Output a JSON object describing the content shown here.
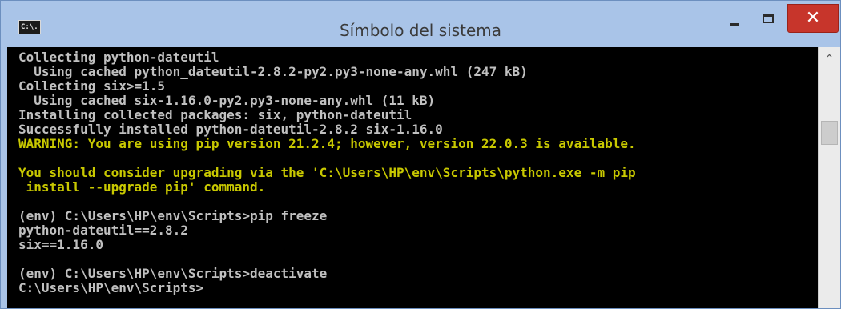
{
  "window": {
    "title": "Símbolo del sistema",
    "icon_label": "C:\\.",
    "icons": {
      "app": "console-icon",
      "minimize": "minimize-icon",
      "maximize": "maximize-icon",
      "close": "close-icon",
      "scroll_up": "chevron-up-icon"
    },
    "controls": {
      "close_glyph": "✕",
      "scroll_up_glyph": "⌃"
    },
    "colors": {
      "title_bar": "#a9c4e8",
      "close_button": "#c7352b",
      "console_background": "#000000",
      "console_text": "#c0c0c0",
      "warning_text": "#c8c800"
    }
  },
  "console": {
    "lines": [
      "Collecting python-dateutil",
      "  Using cached python_dateutil-2.8.2-py2.py3-none-any.whl (247 kB)",
      "Collecting six>=1.5",
      "  Using cached six-1.16.0-py2.py3-none-any.whl (11 kB)",
      "Installing collected packages: six, python-dateutil",
      "Successfully installed python-dateutil-2.8.2 six-1.16.0",
      "WARNING: You are using pip version 21.2.4; however, version 22.0.3 is available.",
      "",
      "You should consider upgrading via the 'C:\\Users\\HP\\env\\Scripts\\python.exe -m pip",
      " install --upgrade pip' command.",
      "",
      "(env) C:\\Users\\HP\\env\\Scripts>pip freeze",
      "python-dateutil==2.8.2",
      "six==1.16.0",
      "",
      "(env) C:\\Users\\HP\\env\\Scripts>deactivate",
      "C:\\Users\\HP\\env\\Scripts>"
    ]
  }
}
